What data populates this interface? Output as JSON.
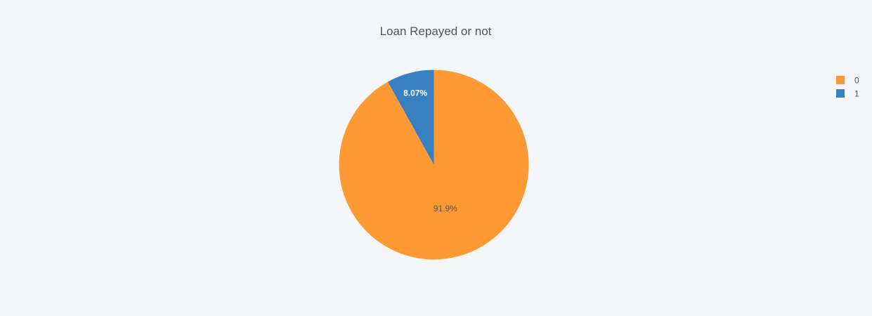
{
  "chart_data": {
    "type": "pie",
    "title": "Loan Repayed or not",
    "slices": [
      {
        "label": "0",
        "value": 91.93,
        "text": "91.9%",
        "color": "#ff9933",
        "text_color": "#4d5663"
      },
      {
        "label": "1",
        "value": 8.07,
        "text": "8.07%",
        "color": "#3880c0",
        "text_color": "#ffffff"
      }
    ],
    "legend": {
      "position": "top-right",
      "items": [
        {
          "label": "0",
          "color": "#ff9933"
        },
        {
          "label": "1",
          "color": "#3880c0"
        }
      ]
    },
    "background": "#f5f6f9"
  }
}
